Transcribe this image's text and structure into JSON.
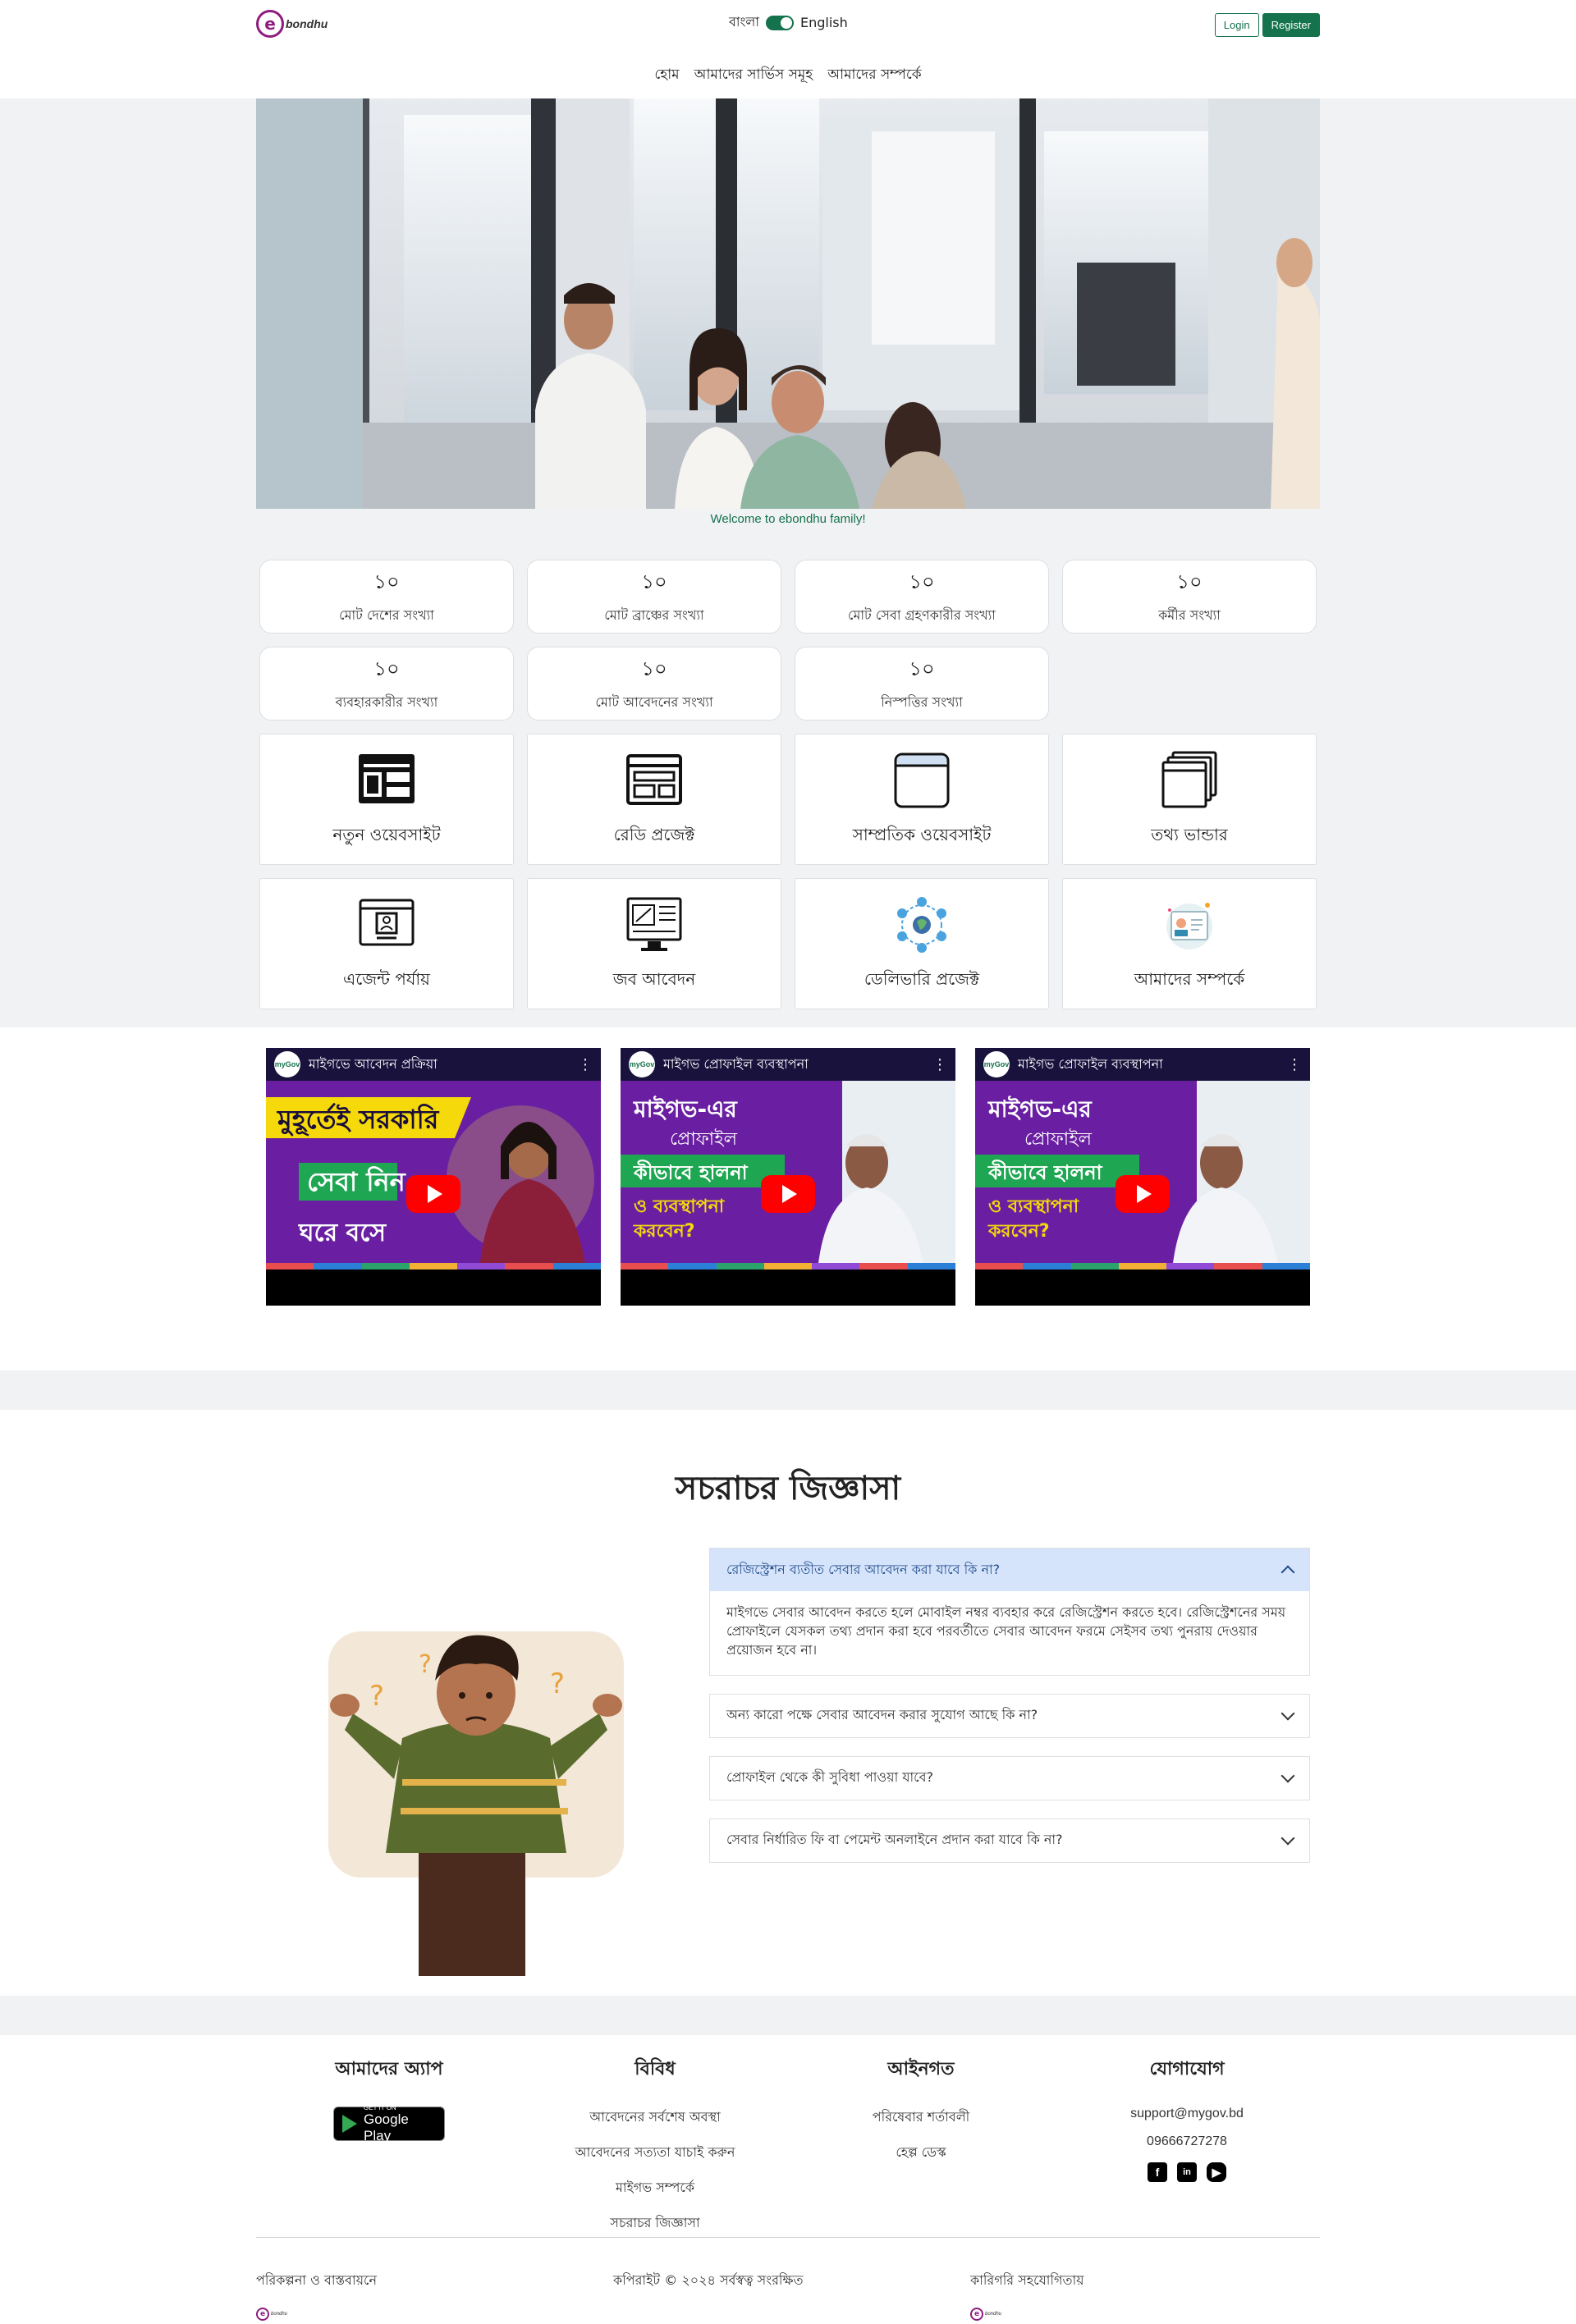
{
  "header": {
    "logo_letter": "e",
    "logo_text": "bondhu",
    "lang_bn": "বাংলা",
    "lang_en": "English",
    "login": "Login",
    "register": "Register"
  },
  "nav": [
    "হোম",
    "আমাদের সার্ভিস সমূহ",
    "আমাদের সম্পর্কে"
  ],
  "hero": {
    "welcome": "Welcome to ebondhu family!"
  },
  "stats": [
    {
      "value": "১০",
      "label": "মোট দেশের সংখ্যা"
    },
    {
      "value": "১০",
      "label": "মোট ব্রাঞ্চের সংখ্যা"
    },
    {
      "value": "১০",
      "label": "মোট সেবা গ্রহণকারীর সংখ্যা"
    },
    {
      "value": "১০",
      "label": "কর্মীর সংখ্যা"
    },
    {
      "value": "১০",
      "label": "ব্যবহারকারীর সংখ্যা"
    },
    {
      "value": "১০",
      "label": "মোট আবেদনের সংখ্যা"
    },
    {
      "value": "১০",
      "label": "নিস্পত্তির সংখ্যা"
    }
  ],
  "tiles": [
    {
      "label": "নতুন ওয়েবসাইট",
      "icon": "website-layout-icon"
    },
    {
      "label": "রেডি প্রজেক্ট",
      "icon": "ready-project-icon"
    },
    {
      "label": "সাম্প্রতিক ওয়েবসাইট",
      "icon": "browser-window-icon"
    },
    {
      "label": "তথ্য ভান্ডার",
      "icon": "stacked-windows-icon"
    },
    {
      "label": "এজেন্ট পর্যায়",
      "icon": "agent-profile-icon"
    },
    {
      "label": "জব আবেদন",
      "icon": "job-monitor-icon"
    },
    {
      "label": "ডেলিভারি প্রজেক্ট",
      "icon": "global-network-icon"
    },
    {
      "label": "আমাদের সম্পর্কে",
      "icon": "about-card-icon"
    }
  ],
  "videos": [
    {
      "title": "মাইগভে আবেদন প্রক্রিয়া",
      "channel": "myGov",
      "lines": [
        "মুহূর্তেই সরকারি",
        "সেবা নিন",
        "ঘরে বসে"
      ]
    },
    {
      "title": "মাইগভ প্রোফাইল ব্যবস্থাপনা",
      "channel": "myGov",
      "lines": [
        "মাইগভ-এর",
        "প্রোফাইল",
        "কীভাবে হালনা",
        "ও ব্যবস্থাপনা",
        "করবেন?"
      ]
    },
    {
      "title": "মাইগভ প্রোফাইল ব্যবস্থাপনা",
      "channel": "myGov",
      "lines": [
        "মাইগভ-এর",
        "প্রোফাইল",
        "কীভাবে হালনা",
        "ও ব্যবস্থাপনা",
        "করবেন?"
      ]
    }
  ],
  "faq": {
    "title": "সচরাচর জিজ্ঞাসা",
    "items": [
      {
        "q": "রেজিস্ট্রেশন ব্যতীত সেবার আবেদন করা যাবে কি না?",
        "a": "মাইগভে সেবার আবেদন করতে হলে মোবাইল নম্বর ব্যবহার করে রেজিস্ট্রেশন করতে হবে। রেজিস্ট্রেশনের সময় প্রোফাইলে যেসকল তথ্য প্রদান করা হবে পরবর্তীতে সেবার আবেদন ফরমে সেইসব তথ্য পুনরায় দেওয়ার প্রয়োজন হবে না।",
        "open": true
      },
      {
        "q": "অন্য কারো পক্ষে সেবার আবেদন করার সুযোগ আছে কি না?",
        "a": "",
        "open": false
      },
      {
        "q": "প্রোফাইল থেকে কী সুবিধা পাওয়া যাবে?",
        "a": "",
        "open": false
      },
      {
        "q": "সেবার নির্ধারিত ফি বা পেমেন্ট অনলাইনে প্রদান করা যাবে কি না?",
        "a": "",
        "open": false
      }
    ]
  },
  "footer": {
    "app_title": "আমাদের অ্যাপ",
    "gplay_small": "GET IT ON",
    "gplay_big": "Google Play",
    "misc_title": "বিবিধ",
    "misc_links": [
      "আবেদনের সর্বশেষ অবস্থা",
      "আবেদনের সত্যতা যাচাই করুন",
      "মাইগভ সম্পর্কে",
      "সচরাচর জিজ্ঞাসা"
    ],
    "legal_title": "আইনগত",
    "legal_links": [
      "পরিষেবার শর্তাবলী",
      "হেল্প ডেস্ক"
    ],
    "contact_title": "যোগাযোগ",
    "email": "support@mygov.bd",
    "phone": "09666727278",
    "social": [
      "facebook-icon",
      "linkedin-icon",
      "youtube-icon"
    ],
    "planning": "পরিকল্পনা ও বাস্তবায়নে",
    "copyright": "কপিরাইট © ২০২৪ সর্বস্বত্ব সংরক্ষিত",
    "tech_support": "কারিগরি সহযোগিতায়"
  }
}
